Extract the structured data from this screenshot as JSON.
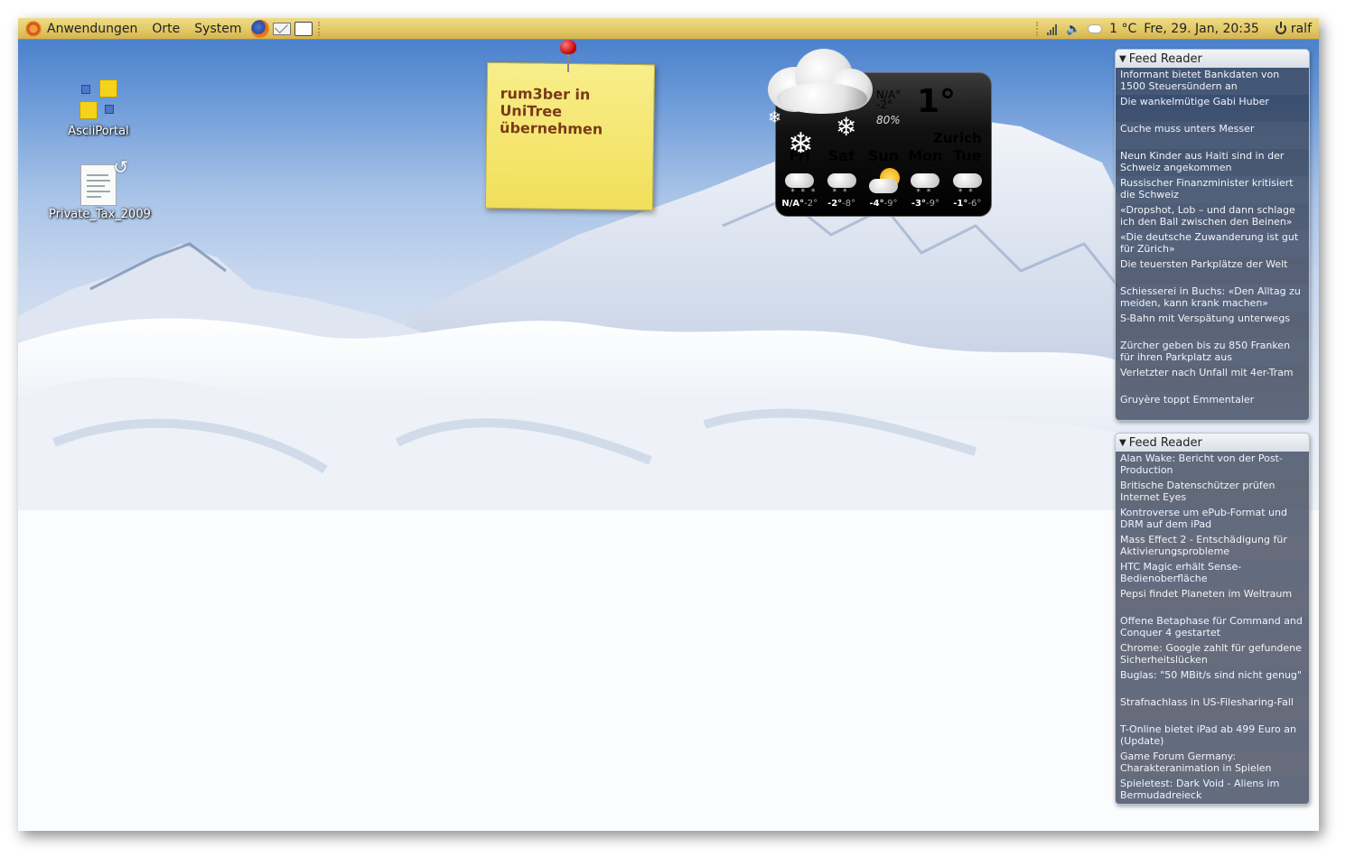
{
  "panel": {
    "menus": [
      "Anwendungen",
      "Orte",
      "System"
    ],
    "launchers": [
      "firefox-icon",
      "mail-icon",
      "chat-icon"
    ],
    "tray": {
      "temperature": "1 °C",
      "datetime": "Fre, 29. Jan, 20:35",
      "user": "ralf"
    }
  },
  "desktop_icons": [
    {
      "label": "AsciiPortal",
      "icon": "ascii-portal-icon"
    },
    {
      "label": "Private_Tax_2009",
      "icon": "document-link-icon"
    }
  ],
  "sticky_note": {
    "text": "rum3ber in UniTree übernehmen"
  },
  "weather": {
    "condition": "N/A°",
    "low": "-2°",
    "humidity": "80%",
    "temperature": "1°",
    "city": "Zurich",
    "forecast": [
      {
        "day": "Fri",
        "high": "N/A°",
        "low": "-2°",
        "icon": "snow-cloud-icon"
      },
      {
        "day": "Sat",
        "high": "-2°",
        "low": "-8°",
        "icon": "snow-cloud-icon"
      },
      {
        "day": "Sun",
        "high": "-4°",
        "low": "-9°",
        "icon": "partly-sunny-icon"
      },
      {
        "day": "Mon",
        "high": "-3°",
        "low": "-9°",
        "icon": "snow-cloud-icon"
      },
      {
        "day": "Tue",
        "high": "-1°",
        "low": "-6°",
        "icon": "snow-cloud-icon"
      }
    ]
  },
  "feeds": [
    {
      "title": "Feed Reader",
      "items": [
        "Informant bietet Bankdaten von 1500 Steuersündern an",
        "Die wankelmütige Gabi Huber",
        "Cuche muss unters Messer",
        "Neun Kinder aus Haiti sind in der Schweiz angekommen",
        "Russischer Finanzminister kritisiert die Schweiz",
        "«Dropshot, Lob – und dann schlage ich den Ball zwischen den Beinen»",
        "«Die deutsche Zuwanderung ist gut für Zürich»",
        "Die teuersten Parkplätze der Welt",
        "Schiesserei in Buchs: «Den Alltag zu meiden, kann krank machen»",
        "S-Bahn mit Verspätung unterwegs",
        "Zürcher geben bis zu 850 Franken für ihren Parkplatz aus",
        "Verletzter nach Unfall mit 4er-Tram",
        "Gruyère toppt Emmentaler"
      ]
    },
    {
      "title": "Feed Reader",
      "items": [
        "Alan Wake: Bericht von der Post-Production",
        "Britische Datenschützer prüfen Internet Eyes",
        "Kontroverse um ePub-Format und DRM auf dem iPad",
        "Mass Effect 2 - Entschädigung für Aktivierungsprobleme",
        "HTC Magic erhält Sense-Bedienoberfläche",
        "Pepsi findet Planeten im Weltraum",
        "Offene Betaphase für Command and Conquer 4 gestartet",
        "Chrome: Google zahlt für gefundene Sicherheitslücken",
        "Buglas: \"50 MBit/s sind nicht genug\"",
        "Strafnachlass in US-Filesharing-Fall",
        "T-Online bietet iPad ab 499 Euro an (Update)",
        "Game Forum Germany: Charakteranimation in Spielen",
        "Spieletest: Dark Void - Aliens im Bermudadreieck"
      ]
    }
  ]
}
